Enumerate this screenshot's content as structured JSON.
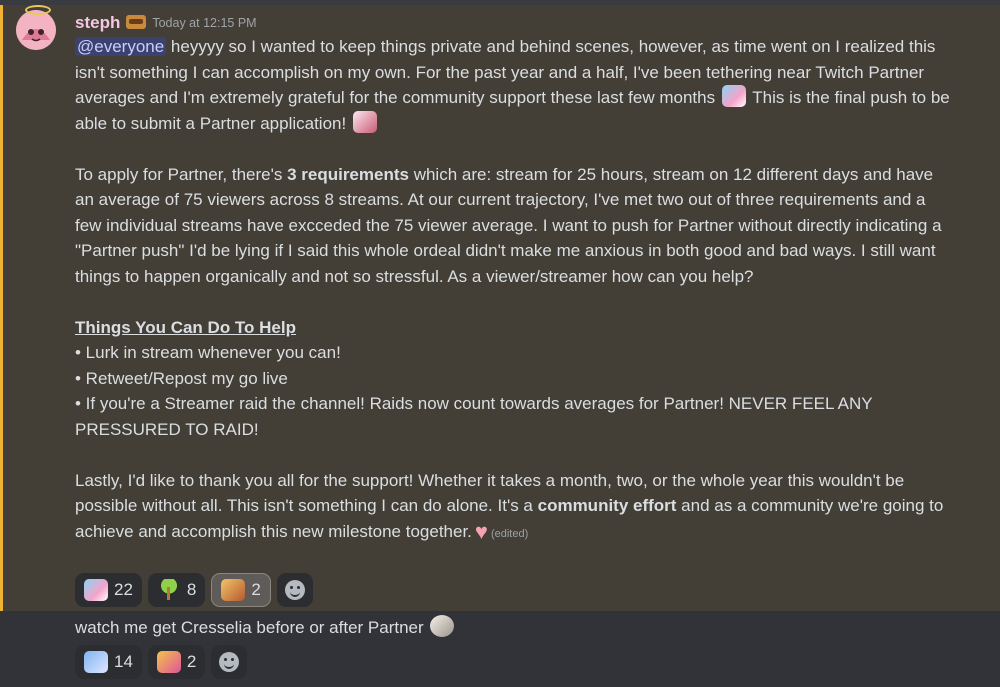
{
  "message": {
    "username": "steph",
    "timestamp": "Today at 12:15 PM",
    "mention": "@everyone",
    "para1_a": " heyyyy so I wanted to keep things private and behind scenes, however, as time went on I realized this isn't something I can accomplish on my own. For the past year and a half, I've been tethering near Twitch Partner averages and I'm extremely grateful for the community support these last few months ",
    "para1_b": " This is the final push to be able to submit a Partner application! ",
    "para2_a": "To apply for Partner, there's ",
    "para2_bold": "3 requirements",
    "para2_b": " which are: stream for 25 hours, stream on 12 different days and have an average of 75 viewers across 8 streams. At our current trajectory, I've met two out of three requirements and a few individual streams have excceded the 75 viewer average. I want to push for Partner without directly indicating a \"Partner push\" I'd be lying if I said this whole ordeal didn't make me anxious in both good and bad ways. I still want things to happen organically and not so stressful. As a viewer/streamer how can you help?",
    "heading": "Things You Can Do To Help",
    "bullets": [
      "• Lurk in stream whenever you can!",
      "• Retweet/Repost my go live",
      "• If you're a Streamer raid the channel! Raids now count towards averages for Partner! NEVER FEEL ANY PRESSURED TO RAID!"
    ],
    "para4_a": "Lastly, I'd like to thank you all for the support! Whether it takes a month, two, or the whole year this wouldn't be possible without all. This isn't something I can do alone. It's a ",
    "para4_bold": "community effort",
    "para4_b": " and as a community we're going to achieve and accomplish this new milestone together.",
    "heart": "♥",
    "edited": "(edited)",
    "reactions": [
      {
        "icon": "anime-girl-emoji",
        "count": "22",
        "active": false
      },
      {
        "icon": "palm-tree-emoji",
        "count": "8",
        "active": false
      },
      {
        "icon": "screaming-face-emoji",
        "count": "2",
        "active": true
      }
    ]
  },
  "followup": {
    "text": "watch me get Cresselia before or after Partner ",
    "reactions": [
      {
        "icon": "sparkle-emoji",
        "count": "14"
      },
      {
        "icon": "party-popper-emoji",
        "count": "2"
      }
    ]
  },
  "colors": {
    "mention_highlight": "#433f37",
    "mention_bar": "#f0b232",
    "username": "#f5c7e0"
  }
}
